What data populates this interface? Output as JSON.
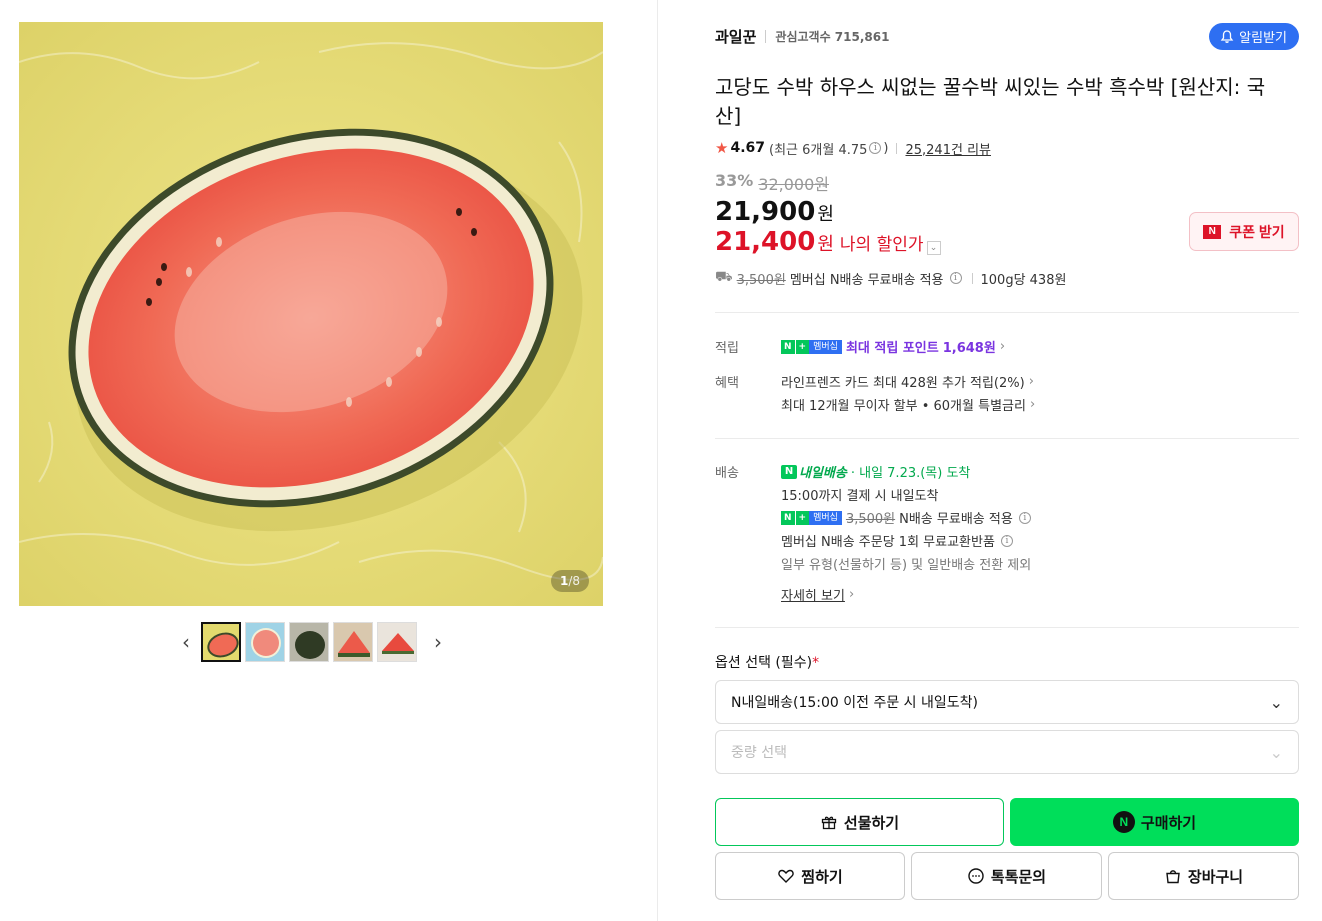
{
  "gallery": {
    "counter_current": "1",
    "counter_total": "/8",
    "thumbnail_count": 5
  },
  "store": {
    "name": "과일꾼",
    "fans_label": "관심고객수 715,861",
    "alarm_button": "알림받기"
  },
  "product": {
    "title": "고당도 수박 하우스 씨없는 꿀수박 씨있는 수박 흑수박 [원산지: 국산]",
    "rating": "4.67",
    "recent_rating": "(최근 6개월 4.75",
    "recent_rating_close": ")",
    "review_count": "25,241건 리뷰"
  },
  "price": {
    "discount_rate": "33%",
    "original_price": "32,000원",
    "sale_price": "21,900",
    "won": "원",
    "my_price": "21,400",
    "my_price_label": "나의 할인가",
    "coupon_button": "쿠폰 받기"
  },
  "shipping_summary": {
    "orig_fee": "3,500원",
    "text": "멤버십 N배송 무료배송 적용",
    "unit_price": "100g당 438원"
  },
  "benefits": {
    "point_label": "적립",
    "point_text": "최대 적립 포인트",
    "point_value": "1,648원",
    "benefit_label": "혜택",
    "card_text": "라인프렌즈 카드 최대 428원 추가 적립(2%)",
    "installment_text": "최대 12개월 무이자 할부 • 60개월 특별금리"
  },
  "delivery": {
    "label": "배송",
    "badge": "내일배송",
    "arrival": "· 내일 7.23.(목) 도착",
    "cutoff": "15:00까지 결제 시 내일도착",
    "member_fee_orig": "3,500원",
    "member_fee_text": "N배송 무료배송 적용",
    "exchange": "멤버십 N배송 주문당 1회 무료교환반품",
    "exception": "일부 유형(선물하기 등) 및 일반배송 전환 제외",
    "more_link": "자세히 보기"
  },
  "options": {
    "title": "옵션 선택 (필수)",
    "required_mark": "*",
    "select1_value": "N내일배송(15:00 이전 주문 시 내일도착)",
    "select2_placeholder": "중량 선택"
  },
  "actions": {
    "gift": "선물하기",
    "buy": "구매하기",
    "wish": "찜하기",
    "talk": "톡톡문의",
    "cart": "장바구니"
  },
  "badges": {
    "n": "N",
    "plus": "+",
    "membership": "멤버십"
  },
  "colors": {
    "accent_blue": "#2e6ff2",
    "sale_red": "#dd1328",
    "naver_green": "#03c75a",
    "buy_green": "#00de5a",
    "point_purple": "#7a34e0"
  }
}
